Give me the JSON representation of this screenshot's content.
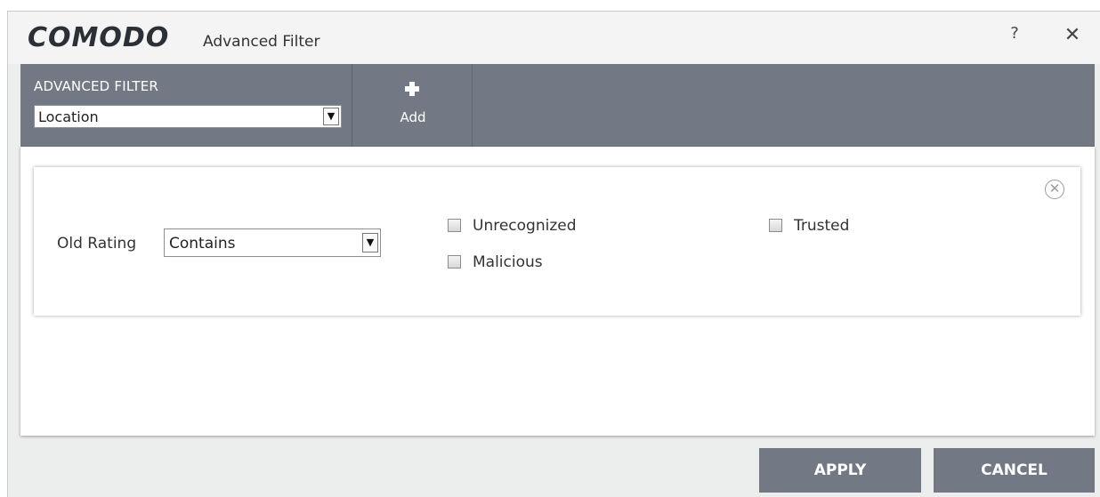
{
  "window": {
    "brand": "COMODO",
    "title": "Advanced Filter",
    "help_label": "?",
    "close_label": "✕"
  },
  "toolbar": {
    "filter_label": "ADVANCED FILTER",
    "filter_type_value": "Location",
    "add_label": "Add"
  },
  "criteria": {
    "field_label": "Old Rating",
    "condition_value": "Contains",
    "options": [
      {
        "label": "Unrecognized",
        "checked": false
      },
      {
        "label": "Trusted",
        "checked": false
      },
      {
        "label": "Malicious",
        "checked": false
      }
    ],
    "remove_icon": "close-circle-icon"
  },
  "footer": {
    "apply_label": "APPLY",
    "cancel_label": "CANCEL"
  },
  "colors": {
    "toolbar_bg": "#727985",
    "window_bg": "#eceded",
    "button_bg": "#727985",
    "button_text": "#ffffff"
  }
}
